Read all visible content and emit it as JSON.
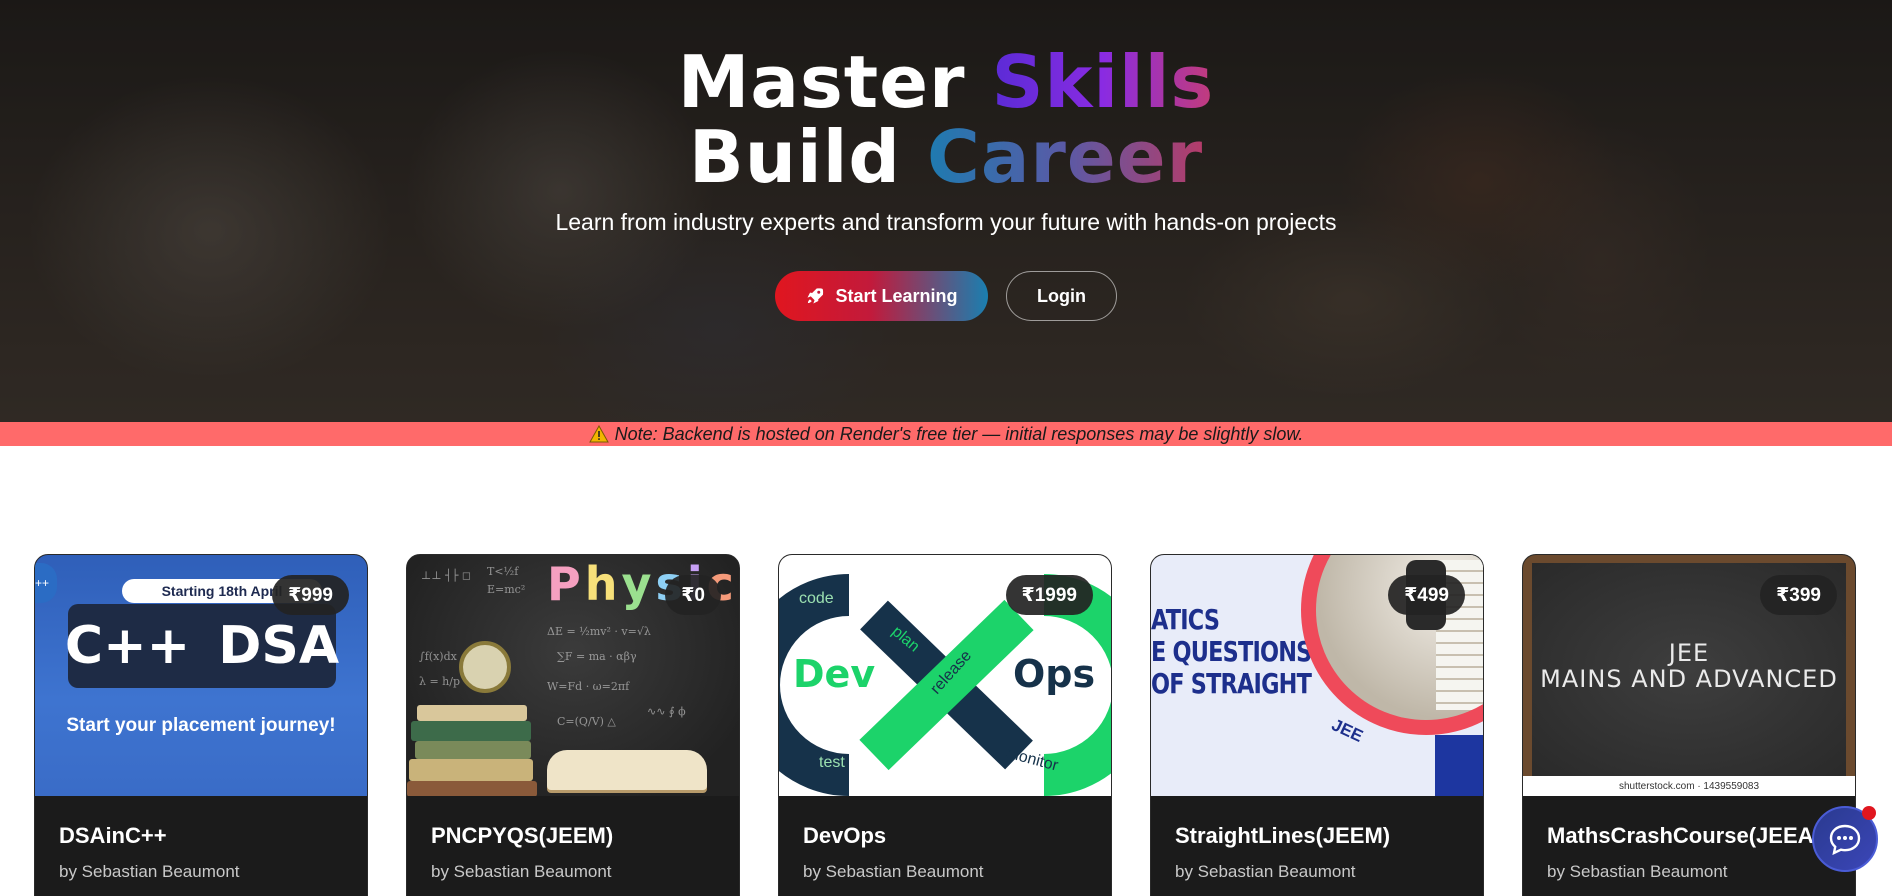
{
  "hero": {
    "title_line1_a": "Master",
    "title_line1_b": "Skills",
    "title_line2_a": "Build",
    "title_line2_b": "Career",
    "subtitle": "Learn from industry experts and transform your future with hands-on projects",
    "start_label": "Start Learning",
    "login_label": "Login"
  },
  "note": {
    "icon": "warning-icon",
    "text": "Note: Backend is hosted on Render's free tier — initial responses may be slightly slow."
  },
  "courses": [
    {
      "title": "DSAinC++",
      "author": "by Sebastian Beaumont",
      "price": "₹999",
      "thumb": {
        "pill": "Starting 18th April",
        "left": "C++",
        "right": "DSA",
        "tagline": "Start your placement journey!"
      }
    },
    {
      "title": "PNCPYQS(JEEM)",
      "author": "by Sebastian Beaumont",
      "price": "₹0",
      "thumb": {
        "word": "Physics"
      }
    },
    {
      "title": "DevOps",
      "author": "by Sebastian Beaumont",
      "price": "₹1999",
      "thumb": {
        "dev": "Dev",
        "ops": "Ops",
        "code": "code",
        "plan": "plan",
        "release": "release",
        "test": "test",
        "monitor": "monitor"
      }
    },
    {
      "title": "StraightLines(JEEM)",
      "author": "by Sebastian Beaumont",
      "price": "₹499",
      "thumb": {
        "line1": "ATICS",
        "line2": "E QUESTIONS",
        "line3": "OF STRAIGHT",
        "jee": "JEE"
      }
    },
    {
      "title": "MathsCrashCourse(JEEA",
      "author": "by Sebastian Beaumont",
      "price": "₹399",
      "thumb": {
        "line1": "JEE",
        "line2": "MAINS AND ADVANCED",
        "credit": "shutterstock.com · 1439559083"
      }
    }
  ],
  "colors": {
    "note_bg": "#ff6a6a",
    "card_bg": "#1b1b1b",
    "start_gradient": [
      "#e0161f",
      "#1a7fb0"
    ]
  }
}
